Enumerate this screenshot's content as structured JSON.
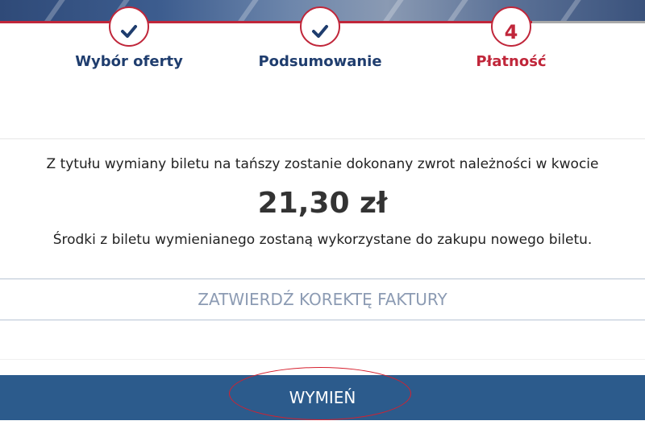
{
  "steps": [
    {
      "label": "Wybór oferty",
      "status": "done",
      "icon": "check-icon"
    },
    {
      "label": "Podsumowanie",
      "status": "done",
      "icon": "check-icon"
    },
    {
      "label": "Płatność",
      "status": "active",
      "number": "4"
    }
  ],
  "colors": {
    "accent_red": "#c0263a",
    "navy": "#1f3d6e",
    "button_blue": "#2c5b8c",
    "muted_link": "#8c9bb3"
  },
  "refund": {
    "message": "Z tytułu wymiany biletu na tańszy zostanie dokonany zwrot należności w kwocie",
    "amount": "21,30 zł",
    "note": "Środki z biletu wymienianego zostaną wykorzystane do zakupu nowego biletu."
  },
  "actions": {
    "confirm_correction_label": "ZATWIERDŹ KOREKTĘ FAKTURY",
    "exchange_label": "WYMIEŃ"
  }
}
